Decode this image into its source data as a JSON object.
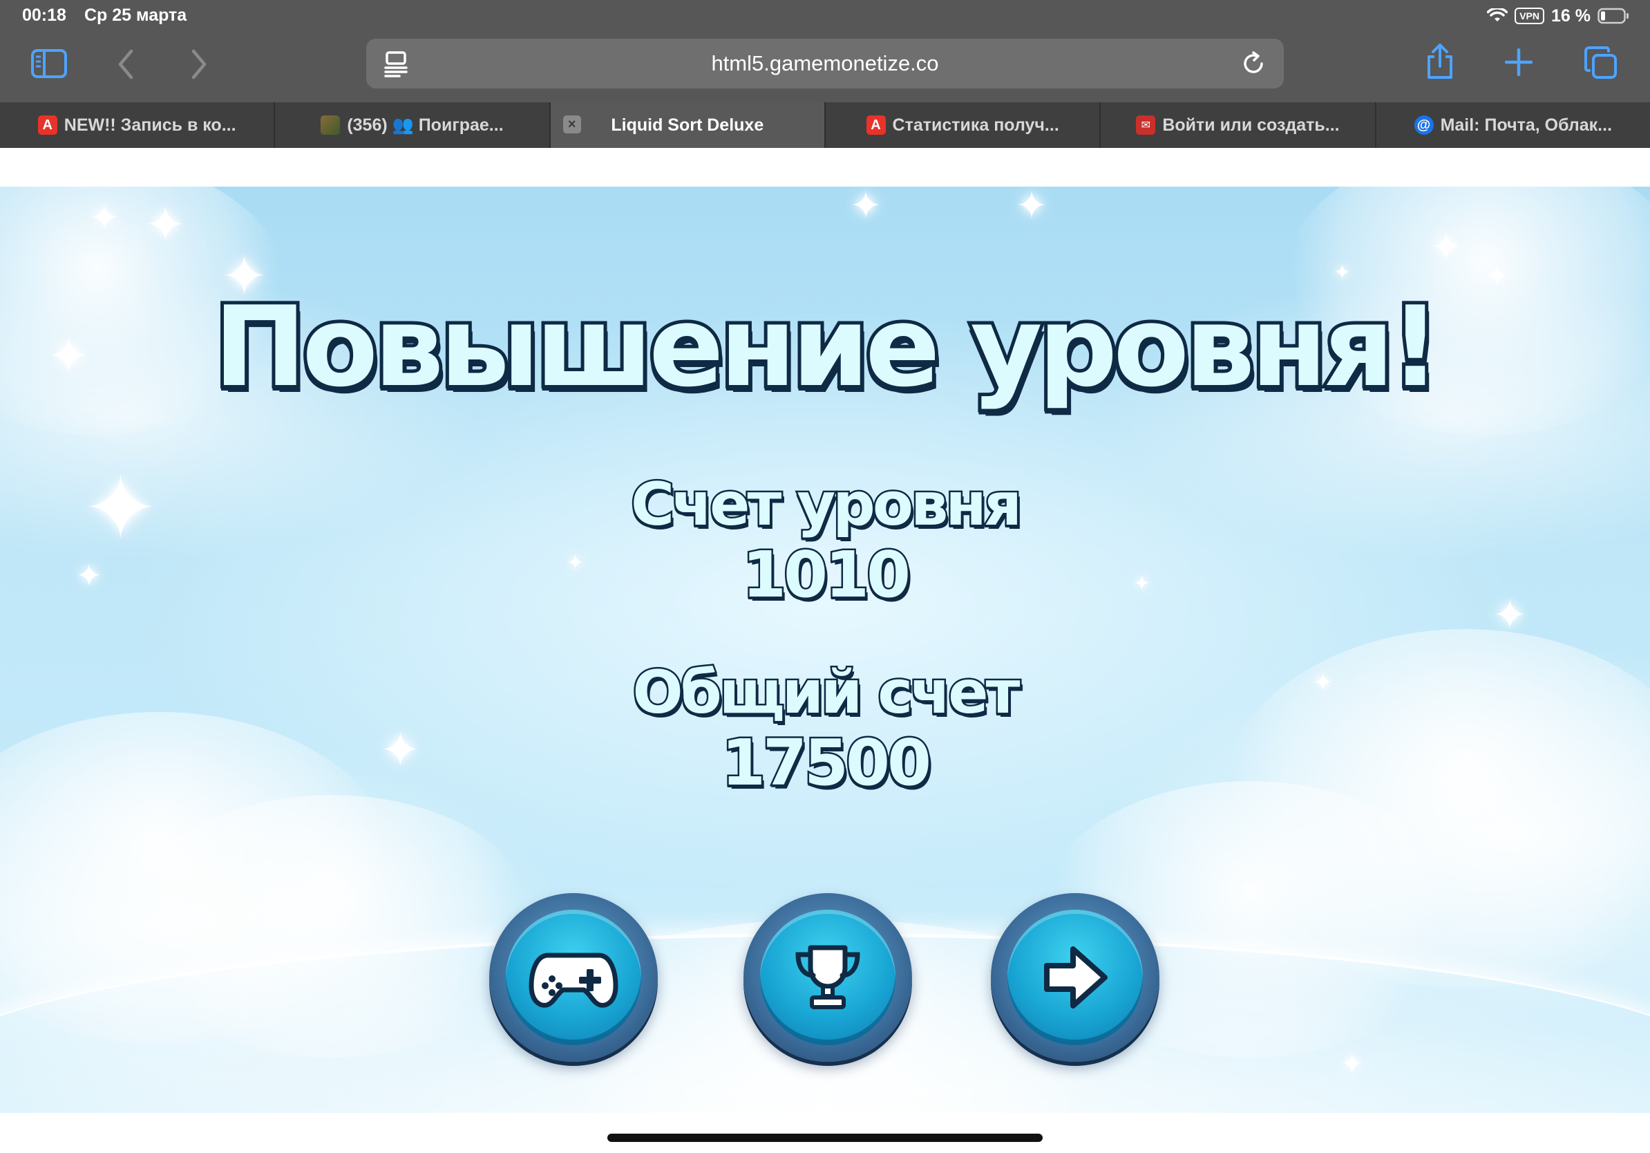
{
  "status_bar": {
    "time": "00:18",
    "date": "Ср 25 марта",
    "vpn": "VPN",
    "battery": "16 %"
  },
  "toolbar": {
    "url": "html5.gamemonetize.co",
    "icons": [
      "sidebar-icon",
      "back-icon",
      "forward-icon",
      "reader-icon",
      "reload-icon",
      "share-icon",
      "new-tab-icon",
      "tabs-icon"
    ]
  },
  "tabs": [
    {
      "label": "NEW!! Запись в ко...",
      "favicon": "A",
      "favicon_color": "#e8332a",
      "active": false
    },
    {
      "label": "(356) 👥 Поиграе...",
      "favicon": "",
      "favicon_color": "#6b4a2a",
      "active": false
    },
    {
      "label": "Liquid Sort Deluxe",
      "favicon": "",
      "favicon_color": "",
      "active": true
    },
    {
      "label": "Статистика получ...",
      "favicon": "A",
      "favicon_color": "#e8332a",
      "active": false
    },
    {
      "label": "Войти или создать...",
      "favicon": "✉",
      "favicon_color": "#c9302c",
      "active": false
    },
    {
      "label": "Mail: Почта, Облак...",
      "favicon": "@",
      "favicon_color": "#1a73e8",
      "active": false
    }
  ],
  "game": {
    "title": "Повышение уровня!",
    "level_score_label": "Счет уровня",
    "level_score_value": "1010",
    "total_score_label": "Общий счет",
    "total_score_value": "17500",
    "buttons": [
      "gamepad-icon",
      "trophy-icon",
      "next-arrow-icon"
    ]
  },
  "colors": {
    "chrome": "#575757",
    "tab_strip": "#3f3f3f",
    "sky": "#bfe7f8",
    "text_fill": "#dcfbff",
    "text_outline": "#0f2a44",
    "button": "#19a6d4",
    "accent": "#1e90ff"
  }
}
